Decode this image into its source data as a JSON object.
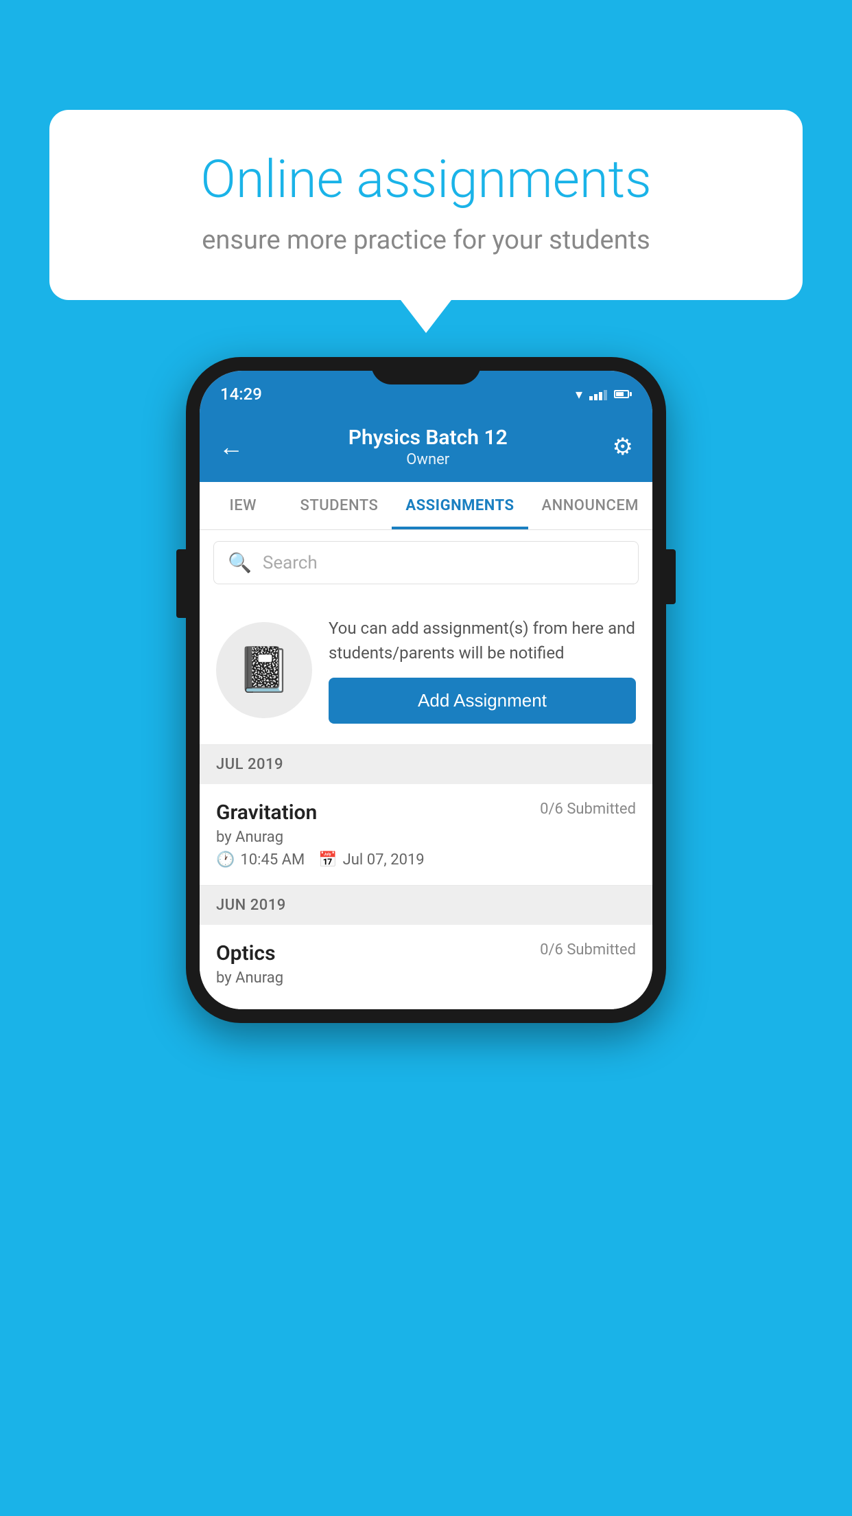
{
  "background_color": "#1ab3e8",
  "speech_bubble": {
    "title": "Online assignments",
    "subtitle": "ensure more practice for your students"
  },
  "phone": {
    "status_bar": {
      "time": "14:29"
    },
    "app_bar": {
      "title": "Physics Batch 12",
      "subtitle": "Owner",
      "back_icon": "←",
      "settings_icon": "⚙"
    },
    "tabs": [
      {
        "label": "IEW",
        "active": false
      },
      {
        "label": "STUDENTS",
        "active": false
      },
      {
        "label": "ASSIGNMENTS",
        "active": true
      },
      {
        "label": "ANNOUNCEM",
        "active": false
      }
    ],
    "search": {
      "placeholder": "Search"
    },
    "promo_card": {
      "description": "You can add assignment(s) from here and students/parents will be notified",
      "button_label": "Add Assignment"
    },
    "sections": [
      {
        "month_label": "JUL 2019",
        "assignments": [
          {
            "title": "Gravitation",
            "submitted": "0/6 Submitted",
            "by": "by Anurag",
            "time": "10:45 AM",
            "date": "Jul 07, 2019"
          }
        ]
      },
      {
        "month_label": "JUN 2019",
        "assignments": [
          {
            "title": "Optics",
            "submitted": "0/6 Submitted",
            "by": "by Anurag",
            "time": "",
            "date": ""
          }
        ]
      }
    ]
  }
}
